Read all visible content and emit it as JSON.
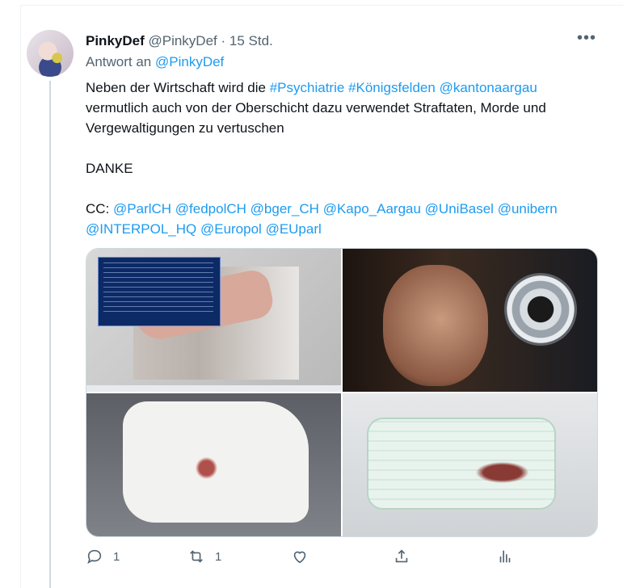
{
  "tweet": {
    "display_name": "PinkyDef",
    "handle": "@PinkyDef",
    "separator": "·",
    "time": "15 Std.",
    "reply_prefix": "Antwort an",
    "reply_to": "@PinkyDef",
    "body": {
      "line1_prefix": "Neben der Wirtschaft wird die",
      "hashtags": [
        "#Psychiatrie",
        "#Königsfelden"
      ],
      "mention": "@kantonaargau",
      "line1_rest": "vermutlich auch von der Oberschicht dazu verwendet Straftaten, Morde und Vergewaltigungen zu vertuschen",
      "thanks": "DANKE",
      "cc_label": "CC:",
      "cc_mentions": [
        "@ParlCH",
        "@fedpolCH",
        "@bger_CH",
        "@Kapo_Aargau",
        "@UniBasel",
        "@unibern",
        "@INTERPOL_HQ",
        "@Europol",
        "@EUparl"
      ]
    },
    "media": [
      {
        "name": "screenshot-with-arm-photo"
      },
      {
        "name": "selfie-with-camera"
      },
      {
        "name": "bloody-tissue"
      },
      {
        "name": "bloody-face-mask"
      }
    ],
    "actions": {
      "reply_count": "1",
      "retweet_count": "1"
    },
    "icons": {
      "more": "more-icon",
      "reply": "reply-icon",
      "retweet": "retweet-icon",
      "like": "like-icon",
      "share": "share-icon",
      "analytics": "analytics-icon"
    },
    "colors": {
      "link": "#1d9bf0",
      "secondary_text": "#536471",
      "primary_text": "#0f1419"
    }
  }
}
